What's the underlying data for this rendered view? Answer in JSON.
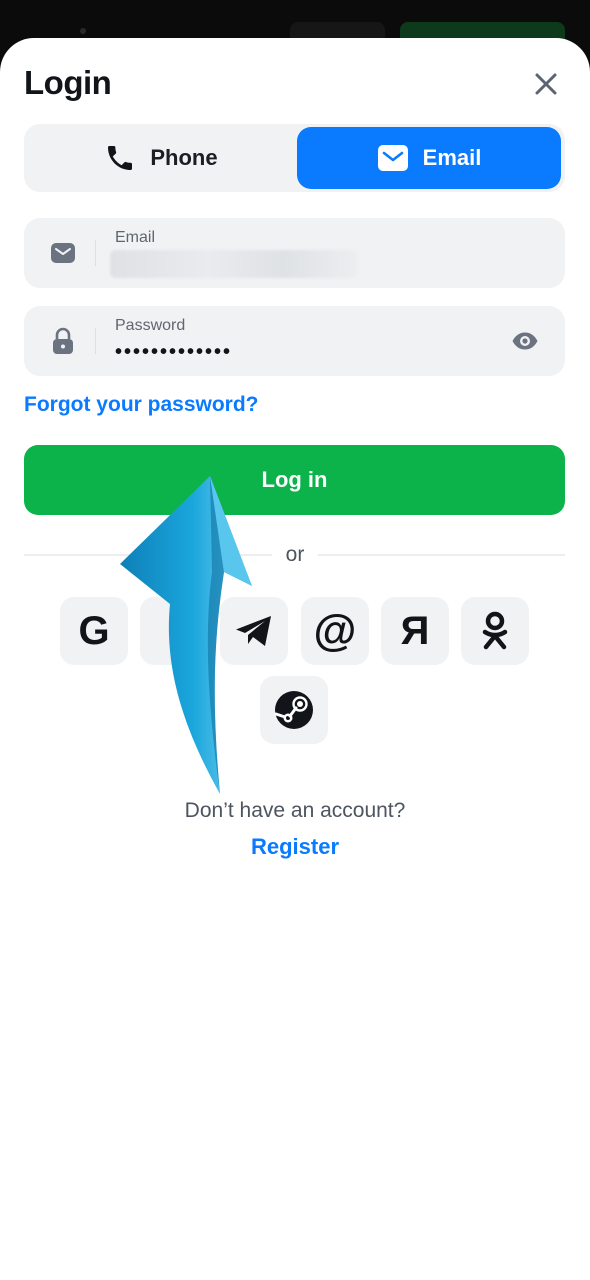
{
  "header": {
    "title": "Login",
    "close_icon": "close-icon"
  },
  "tabs": [
    {
      "label": "Phone",
      "icon": "phone-icon",
      "selected": false
    },
    {
      "label": "Email",
      "icon": "envelope-icon",
      "selected": true
    }
  ],
  "email_field": {
    "label": "Email",
    "value_redacted": true,
    "icon": "envelope-icon"
  },
  "password_field": {
    "label": "Password",
    "value": "•••••••••••••",
    "icon": "lock-icon",
    "toggle_icon": "eye-icon"
  },
  "links": {
    "forgot": "Forgot your password?",
    "no_account": "Don’t have an account?",
    "register": "Register"
  },
  "login_button": {
    "label": "Log in"
  },
  "divider": {
    "label": "or"
  },
  "social": [
    {
      "name": "google",
      "glyph": "G"
    },
    {
      "name": "vk",
      "glyph": ""
    },
    {
      "name": "telegram",
      "glyph": ""
    },
    {
      "name": "mail",
      "glyph": "@"
    },
    {
      "name": "yandex",
      "glyph": "Я"
    },
    {
      "name": "odnoklassniki",
      "glyph": ""
    },
    {
      "name": "steam",
      "glyph": ""
    }
  ],
  "colors": {
    "accent": "#0a7bff",
    "primary_button": "#0bb34a",
    "field_bg": "#f1f2f4",
    "annotation_arrow": "#1a9fd6"
  }
}
